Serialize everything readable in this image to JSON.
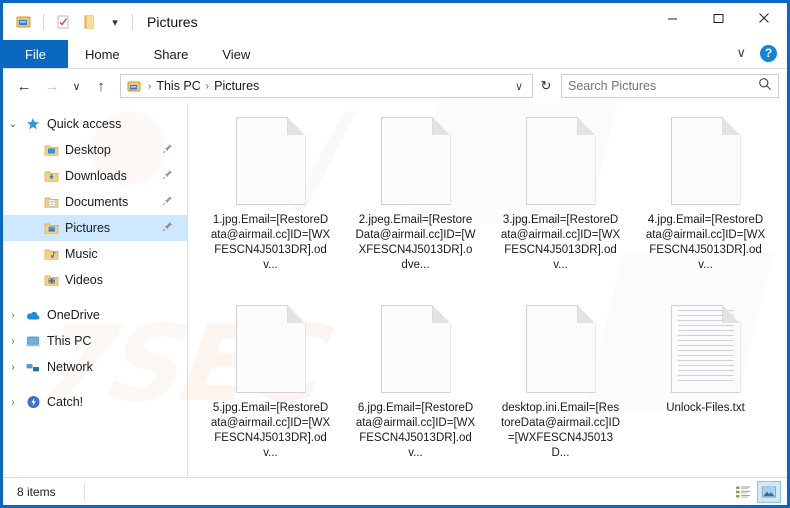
{
  "window": {
    "title": "Pictures",
    "accent_color": "#0a68c1",
    "selection_color": "#cde8ff",
    "controls": {
      "minimize": "–",
      "maximize": "□",
      "close": "✕"
    },
    "quick_access_toolbar": [
      {
        "name": "properties-icon",
        "glyph": ""
      },
      {
        "name": "new-folder-icon",
        "glyph": ""
      },
      {
        "name": "folder-icon",
        "glyph": ""
      },
      {
        "name": "chevron-down-icon",
        "glyph": "▾"
      }
    ]
  },
  "ribbon": {
    "tabs": [
      {
        "label": "File",
        "active": true
      },
      {
        "label": "Home",
        "active": false
      },
      {
        "label": "Share",
        "active": false
      },
      {
        "label": "View",
        "active": false
      }
    ],
    "collapse_glyph": "∨",
    "help_label": "?"
  },
  "address_bar": {
    "back_glyph": "←",
    "forward_glyph": "→",
    "recent_glyph": "∨",
    "up_glyph": "↑",
    "breadcrumbs": [
      "This PC",
      "Pictures"
    ],
    "separator": "›",
    "dropdown_glyph": "∨",
    "refresh_glyph": "↻",
    "search": {
      "value": "",
      "placeholder": "Search Pictures",
      "icon": "search-icon"
    }
  },
  "sidebar": {
    "items": [
      {
        "label": "Quick access",
        "icon": "star-icon",
        "twisty": "⌄",
        "indent": false,
        "pinned": false,
        "selected": false
      },
      {
        "label": "Desktop",
        "icon": "folder-desktop-icon",
        "twisty": "",
        "indent": true,
        "pinned": true,
        "selected": false
      },
      {
        "label": "Downloads",
        "icon": "folder-downloads-icon",
        "twisty": "",
        "indent": true,
        "pinned": true,
        "selected": false
      },
      {
        "label": "Documents",
        "icon": "folder-documents-icon",
        "twisty": "",
        "indent": true,
        "pinned": true,
        "selected": false
      },
      {
        "label": "Pictures",
        "icon": "folder-pictures-icon",
        "twisty": "",
        "indent": true,
        "pinned": true,
        "selected": true
      },
      {
        "label": "Music",
        "icon": "folder-music-icon",
        "twisty": "",
        "indent": true,
        "pinned": false,
        "selected": false
      },
      {
        "label": "Videos",
        "icon": "folder-videos-icon",
        "twisty": "",
        "indent": true,
        "pinned": false,
        "selected": false
      }
    ],
    "roots": [
      {
        "label": "OneDrive",
        "icon": "onedrive-icon",
        "twisty": "›"
      },
      {
        "label": "This PC",
        "icon": "this-pc-icon",
        "twisty": "›"
      },
      {
        "label": "Network",
        "icon": "network-icon",
        "twisty": "›"
      },
      {
        "label": "Catch!",
        "icon": "catch-icon",
        "twisty": "›"
      }
    ]
  },
  "files": [
    {
      "name": "1.jpg.Email=[RestoreData@airmail.cc]ID=[WXFESCN4J5013DR].odv...",
      "icon": "blank-document-icon"
    },
    {
      "name": "2.jpeg.Email=[RestoreData@airmail.cc]ID=[WXFESCN4J5013DR].odve...",
      "icon": "blank-document-icon"
    },
    {
      "name": "3.jpg.Email=[RestoreData@airmail.cc]ID=[WXFESCN4J5013DR].odv...",
      "icon": "blank-document-icon"
    },
    {
      "name": "4.jpg.Email=[RestoreData@airmail.cc]ID=[WXFESCN4J5013DR].odv...",
      "icon": "blank-document-icon"
    },
    {
      "name": "5.jpg.Email=[RestoreData@airmail.cc]ID=[WXFESCN4J5013DR].odv...",
      "icon": "blank-document-icon"
    },
    {
      "name": "6.jpg.Email=[RestoreData@airmail.cc]ID=[WXFESCN4J5013DR].odv...",
      "icon": "blank-document-icon"
    },
    {
      "name": "desktop.ini.Email=[RestoreData@airmail.cc]ID=[WXFESCN4J5013D...",
      "icon": "blank-document-icon"
    },
    {
      "name": "Unlock-Files.txt",
      "icon": "text-document-icon"
    }
  ],
  "status_bar": {
    "item_count": "8 items",
    "views": [
      {
        "name": "details-view-button",
        "active": false
      },
      {
        "name": "large-icons-view-button",
        "active": true
      }
    ]
  },
  "watermarks": {
    "text_big": "7SEC",
    "text_grey": "/"
  }
}
